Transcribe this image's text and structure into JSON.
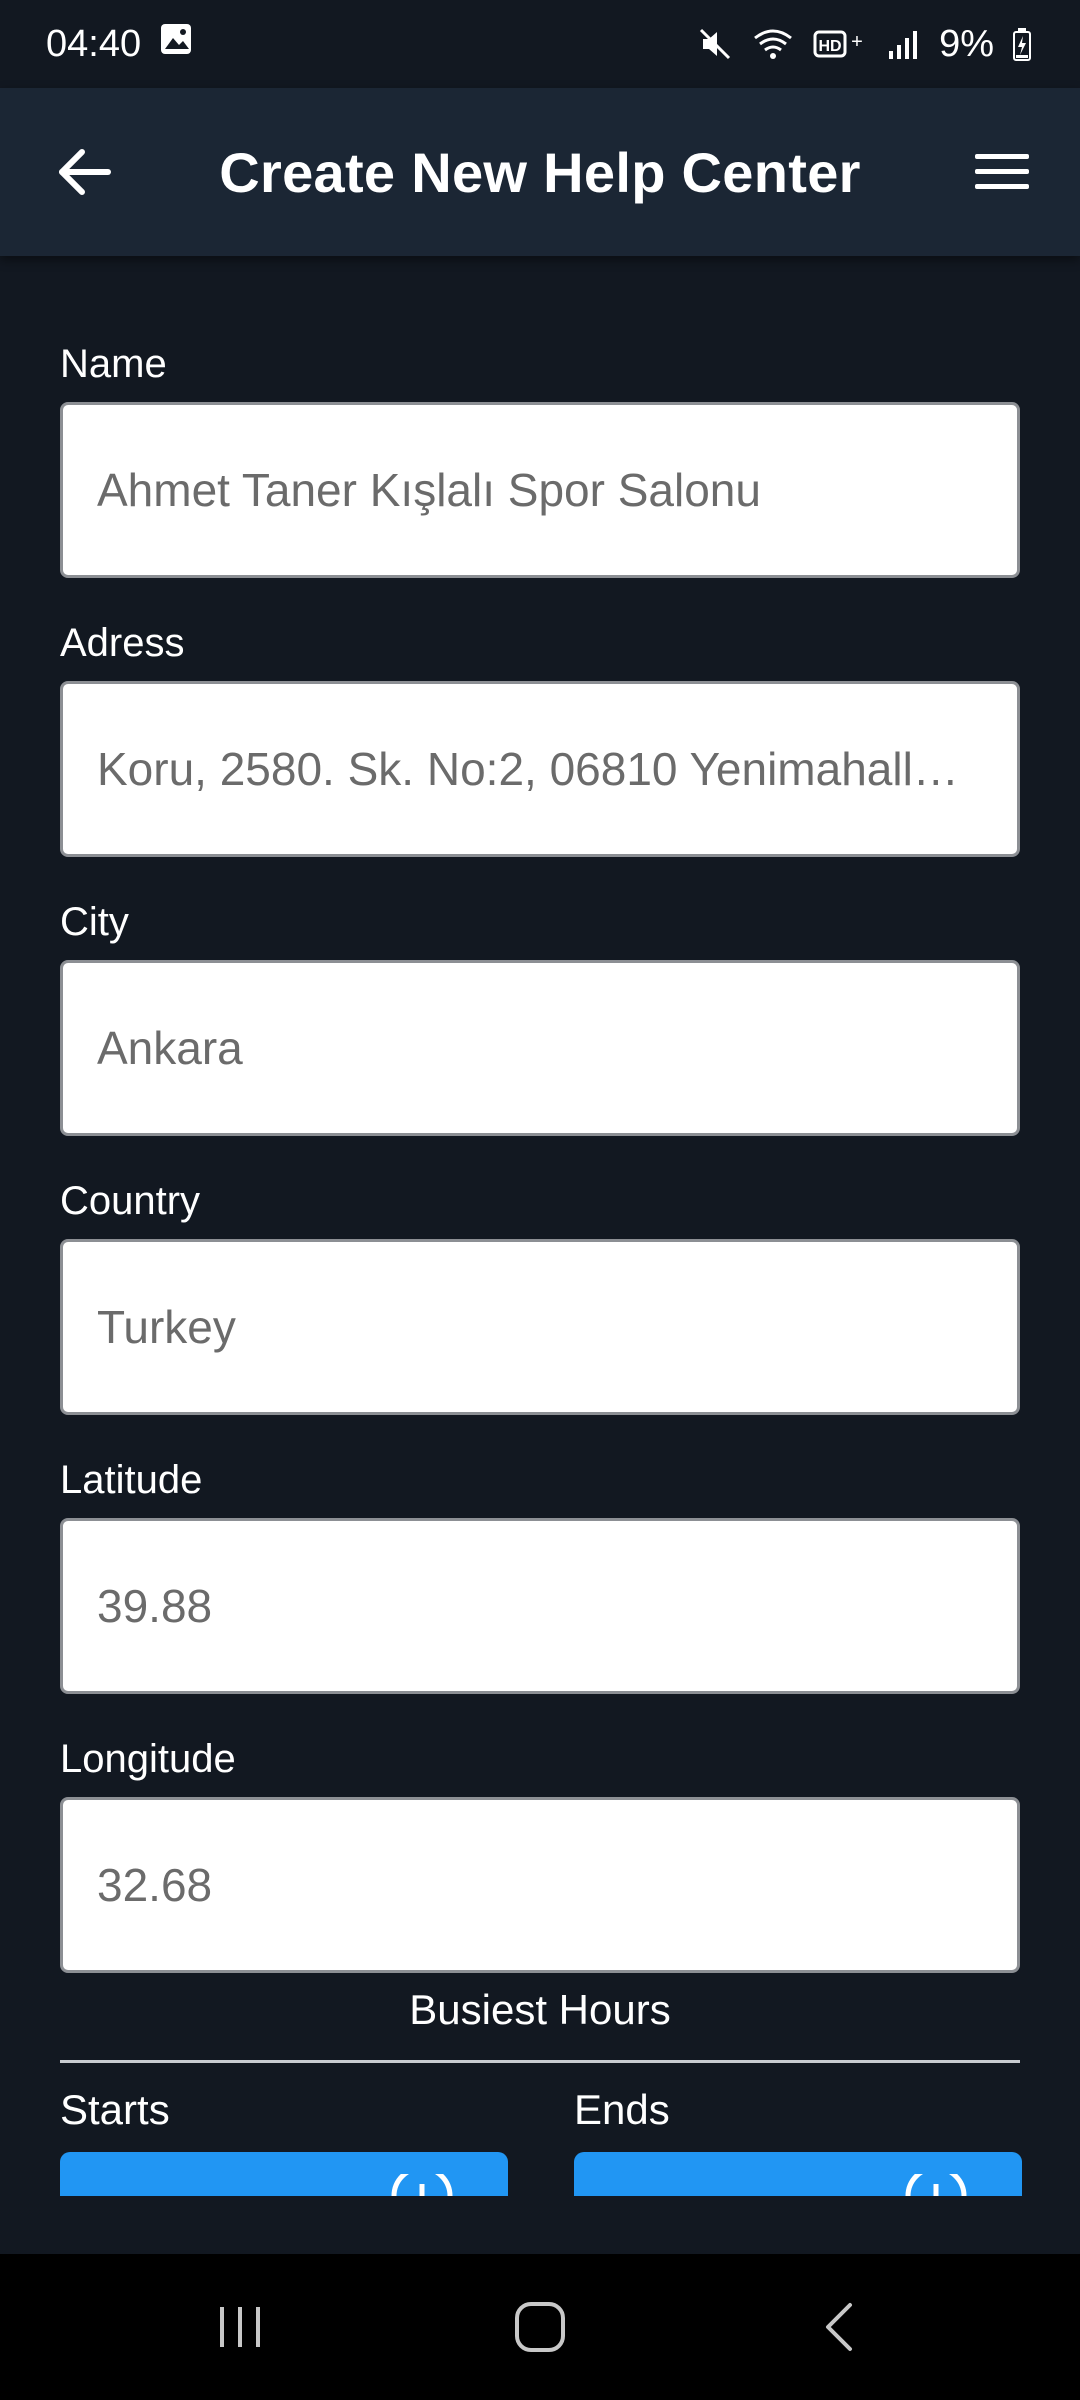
{
  "status_bar": {
    "time": "04:40",
    "battery": "9%",
    "icons": [
      "image-icon",
      "mute-icon",
      "wifi-icon",
      "hd-plus-icon",
      "signal-icon",
      "battery-icon"
    ]
  },
  "app_bar": {
    "title": "Create New Help Center",
    "back_icon": "arrow-left-icon",
    "menu_icon": "hamburger-menu-icon"
  },
  "form": {
    "fields": [
      {
        "label": "Name",
        "value": "Ahmet Taner Kışlalı Spor Salonu"
      },
      {
        "label": "Adress",
        "value": "Koru, 2580. Sk. No:2, 06810 Yenimahall…"
      },
      {
        "label": "City",
        "value": "Ankara"
      },
      {
        "label": "Country",
        "value": "Turkey"
      },
      {
        "label": "Latitude",
        "value": "39.88"
      },
      {
        "label": "Longitude",
        "value": "32.68"
      }
    ],
    "busiest_hours": {
      "title": "Busiest Hours",
      "starts_label": "Starts",
      "ends_label": "Ends",
      "button_color": "#2196f3"
    }
  },
  "nav_bar": {
    "icons": [
      "recent-apps-icon",
      "home-icon",
      "back-icon"
    ]
  },
  "colors": {
    "background": "#121821",
    "app_bar": "#1b2634",
    "accent": "#2196f3"
  }
}
